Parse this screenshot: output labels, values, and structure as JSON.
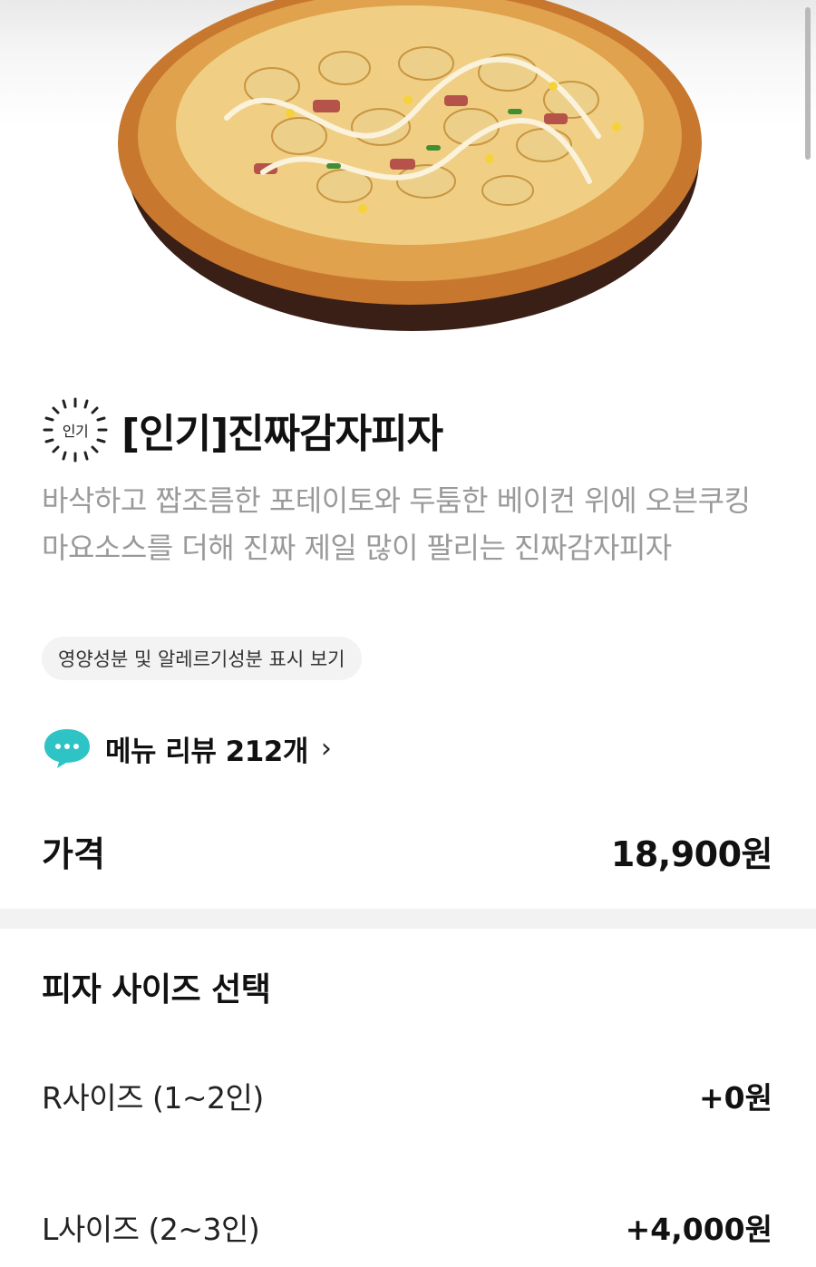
{
  "product": {
    "badge": "인기",
    "title": "[인기]진짜감자피자",
    "description": "바삭하고 짭조름한 포테이토와 두툼한 베이컨 위에 오븐쿠킹 마요소스를 더해 진짜 제일 많이 팔리는 진짜감자피자",
    "nutrition_link": "영양성분 및 알레르기성분 표시 보기",
    "review_link": "메뉴 리뷰 212개"
  },
  "price": {
    "label": "가격",
    "value": "18,900원"
  },
  "size_section": {
    "title": "피자 사이즈 선택",
    "options": [
      {
        "label": "R사이즈 (1~2인)",
        "price": "+0원"
      },
      {
        "label": "L사이즈 (2~3인)",
        "price": "+4,000원"
      }
    ]
  },
  "icons": {
    "badge": "sunburst-badge-icon",
    "review": "chat-bubble-icon",
    "chevron": "chevron-right-icon"
  },
  "colors": {
    "accent_chat": "#2ec4c6",
    "muted_text": "#9a9a9a"
  }
}
